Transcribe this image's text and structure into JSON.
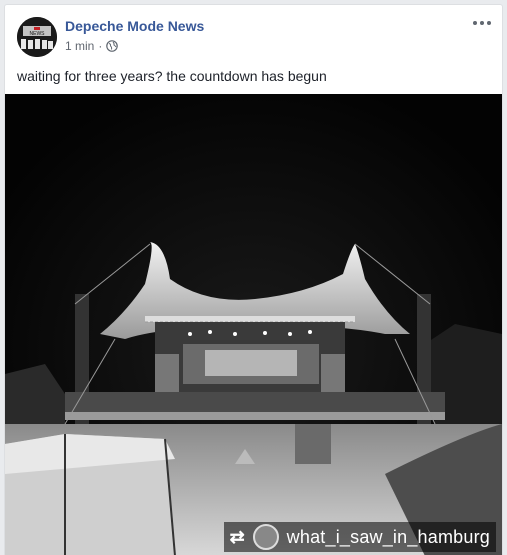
{
  "post": {
    "page_name": "Depeche Mode News",
    "timestamp": "1 min",
    "separator": "·",
    "privacy_icon": "globe-icon",
    "more_icon": "more-options-icon",
    "caption": "waiting for three years? the countdown has begun",
    "avatar_text": "NEWS"
  },
  "photo": {
    "subject": "tent-stage-icon",
    "watermark": {
      "repost_icon": "repost-icon",
      "handle": "what_i_saw_in_hamburg"
    }
  },
  "colors": {
    "link": "#385898",
    "meta": "#616770",
    "text": "#1d2129"
  }
}
